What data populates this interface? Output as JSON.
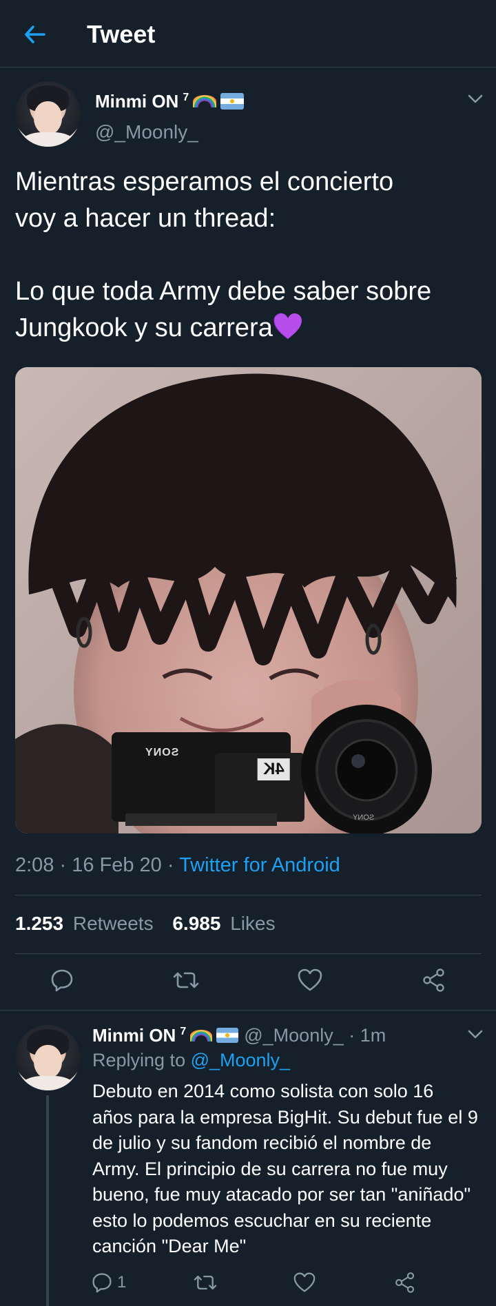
{
  "header": {
    "title": "Tweet",
    "accent": "#1da1f2"
  },
  "tweet": {
    "display_name": "Minmi ON",
    "superscript": "7",
    "handle": "@_Moonly_",
    "text": "Mientras esperamos el concierto\nvoy a hacer un thread:\n\nLo que toda Army debe saber sobre\nJungkook y su carrera",
    "media_image": "photo of Jungkook holding a Sony 4K camcorder",
    "camera_brand": "SONY",
    "camera_badge": "4K",
    "timestamp": "2:08 · 16 Feb 20 · ",
    "source": "Twitter for Android",
    "retweets_count": "1.253",
    "retweets_label": "Retweets",
    "likes_count": "6.985",
    "likes_label": "Likes"
  },
  "reply": {
    "display_name": "Minmi ON",
    "superscript": "7",
    "handle_time": "@_Moonly_ · 1m",
    "replying_prefix": "Replying to ",
    "replying_handle": "@_Moonly_",
    "text": "Debuto en 2014 como solista con solo 16 años para la empresa BigHit. Su debut fue el 9 de julio y su fandom recibió el nombre de Army. El principio de su carrera no fue muy bueno, fue muy atacado por ser tan \"aniñado\" esto lo podemos escuchar en su reciente canción \"Dear Me\"",
    "reply_count": "1"
  },
  "icons": {
    "back": "arrow-left-icon",
    "chevron": "chevron-down-icon",
    "reply": "reply-icon",
    "retweet": "retweet-icon",
    "like": "heart-icon",
    "share": "share-icon"
  },
  "colors": {
    "background": "#15202b",
    "secondary_text": "#8899a6",
    "divider": "#38444d",
    "link": "#1da1f2"
  }
}
